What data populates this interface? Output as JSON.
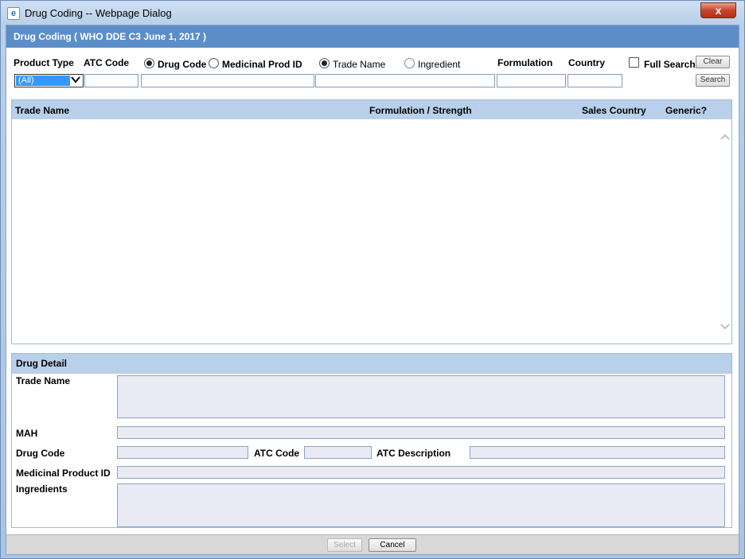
{
  "window": {
    "title": "Drug Coding -- Webpage Dialog",
    "close_label": "x"
  },
  "header": {
    "title": "Drug Coding ( WHO DDE C3 June 1, 2017 )"
  },
  "search": {
    "product_type_label": "Product Type",
    "product_type_value": "(All)",
    "atc_code_label": "ATC Code",
    "code_mode": {
      "selected": "Drug Code",
      "options": [
        "Drug Code",
        "Medicinal Prod ID"
      ]
    },
    "name_mode": {
      "selected": "Trade Name",
      "options": [
        "Trade Name",
        "Ingredient"
      ]
    },
    "formulation_label": "Formulation",
    "country_label": "Country",
    "full_search_label": "Full Search",
    "full_search_checked": false,
    "clear_label": "Clear",
    "search_label": "Search"
  },
  "results_table": {
    "columns": [
      "Trade Name",
      "Formulation / Strength",
      "Sales Country",
      "Generic?"
    ],
    "rows": []
  },
  "drug_detail": {
    "title": "Drug Detail",
    "trade_name_label": "Trade Name",
    "mah_label": "MAH",
    "drug_code_label": "Drug Code",
    "atc_code_label": "ATC Code",
    "atc_description_label": "ATC Description",
    "medicinal_product_id_label": "Medicinal Product ID",
    "ingredients_label": "Ingredients"
  },
  "footer": {
    "select_label": "Select",
    "cancel_label": "Cancel"
  }
}
